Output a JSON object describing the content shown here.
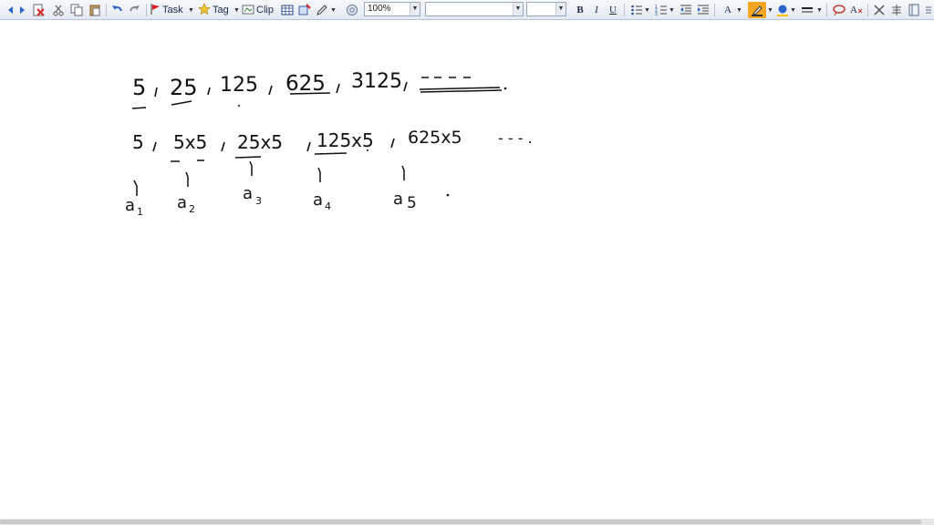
{
  "toolbar": {
    "task_label": "Task",
    "tag_label": "Tag",
    "clip_label": "Clip",
    "zoom_value": "100%",
    "font_name_value": "",
    "font_size_value": "",
    "bold_label": "B",
    "italic_label": "I",
    "underline_label": "U",
    "font_color_label": "A",
    "clear_format_label": "A",
    "highlight_color": "#f5a623",
    "icons": [
      "back-icon",
      "forward-icon",
      "delete-icon",
      "cut-icon",
      "copy-icon",
      "paste-icon",
      "undo-icon",
      "redo-icon",
      "task-flag-icon",
      "tag-star-icon",
      "clip-icon",
      "table-icon",
      "insert-icon",
      "pen-icon",
      "link-icon",
      "bullets-icon",
      "numbering-icon",
      "outdent-icon",
      "indent-icon",
      "font-color-icon",
      "highlighter-icon",
      "fill-color-icon",
      "line-style-icon",
      "lasso-icon",
      "clear-format-icon",
      "close-icon",
      "align-icon",
      "panel-icon"
    ]
  },
  "notes": {
    "line1": {
      "terms": [
        "5",
        "25",
        "125",
        "625",
        "3125"
      ]
    },
    "line2": {
      "terms": [
        "5",
        "5x5",
        "25x5",
        "125x5",
        "625x5"
      ],
      "ellipsis": "- - -   ."
    },
    "labels": [
      {
        "letter": "a",
        "sub": "1"
      },
      {
        "letter": "a",
        "sub": "2"
      },
      {
        "letter": "a",
        "sub": "3"
      },
      {
        "letter": "a",
        "sub": "4"
      },
      {
        "letter": "a",
        "sub": "5"
      }
    ]
  }
}
